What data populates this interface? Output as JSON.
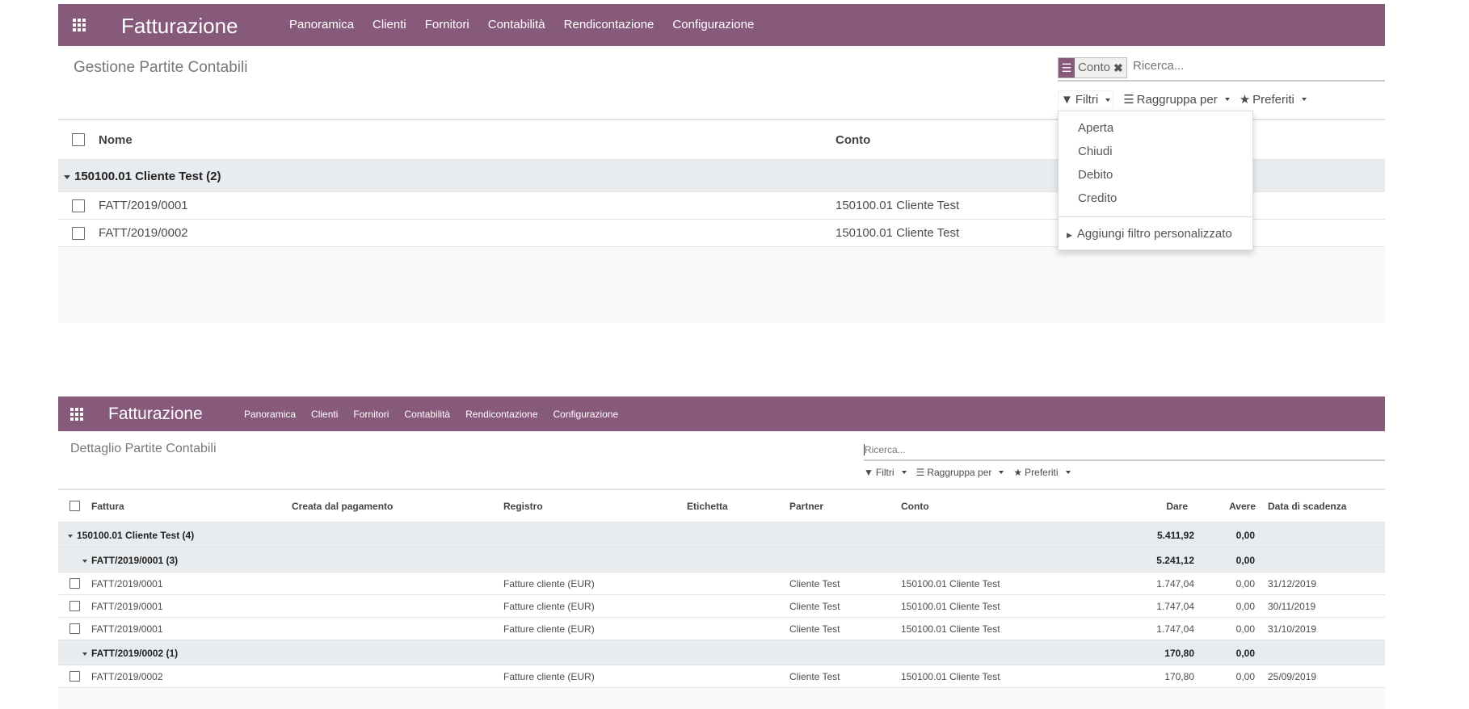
{
  "colors": {
    "brand": "#875a7b",
    "group_bg": "#e9ecef"
  },
  "top": {
    "app_title": "Fatturazione",
    "menu": [
      "Panoramica",
      "Clienti",
      "Fornitori",
      "Contabilità",
      "Rendicontazione",
      "Configurazione"
    ],
    "page_title": "Gestione Partite Contabili",
    "search": {
      "facet": "Conto",
      "placeholder": "Ricerca..."
    },
    "toolbar": {
      "filters": "Filtri",
      "group_by": "Raggruppa per",
      "favorites": "Preferiti"
    },
    "columns": {
      "name": "Nome",
      "account": "Conto"
    },
    "group": {
      "label": "150100.01 Cliente Test (2)"
    },
    "rows": [
      {
        "name": "FATT/2019/0001",
        "account": "150100.01 Cliente Test"
      },
      {
        "name": "FATT/2019/0002",
        "account": "150100.01 Cliente Test"
      }
    ],
    "filter_menu": {
      "items": [
        "Aperta",
        "Chiudi",
        "Debito",
        "Credito"
      ],
      "custom": "Aggiungi filtro personalizzato"
    }
  },
  "bottom": {
    "app_title": "Fatturazione",
    "menu": [
      "Panoramica",
      "Clienti",
      "Fornitori",
      "Contabilità",
      "Rendicontazione",
      "Configurazione"
    ],
    "page_title": "Dettaglio Partite Contabili",
    "search": {
      "placeholder": "Ricerca..."
    },
    "toolbar": {
      "filters": "Filtri",
      "group_by": "Raggruppa per",
      "favorites": "Preferiti"
    },
    "columns": {
      "invoice": "Fattura",
      "created_by_payment": "Creata dal pagamento",
      "journal": "Registro",
      "label": "Etichetta",
      "partner": "Partner",
      "account": "Conto",
      "debit": "Dare",
      "credit": "Avere",
      "due_date": "Data di scadenza"
    },
    "lines": [
      {
        "type": "group",
        "level": 0,
        "label": "150100.01 Cliente Test (4)",
        "debit": "5.411,92",
        "credit": "0,00"
      },
      {
        "type": "group",
        "level": 1,
        "label": "FATT/2019/0001 (3)",
        "debit": "5.241,12",
        "credit": "0,00"
      },
      {
        "type": "row",
        "invoice": "FATT/2019/0001",
        "journal": "Fatture cliente (EUR)",
        "partner": "Cliente Test",
        "account": "150100.01 Cliente Test",
        "debit": "1.747,04",
        "credit": "0,00",
        "due_date": "31/12/2019"
      },
      {
        "type": "row",
        "invoice": "FATT/2019/0001",
        "journal": "Fatture cliente (EUR)",
        "partner": "Cliente Test",
        "account": "150100.01 Cliente Test",
        "debit": "1.747,04",
        "credit": "0,00",
        "due_date": "30/11/2019"
      },
      {
        "type": "row",
        "invoice": "FATT/2019/0001",
        "journal": "Fatture cliente (EUR)",
        "partner": "Cliente Test",
        "account": "150100.01 Cliente Test",
        "debit": "1.747,04",
        "credit": "0,00",
        "due_date": "31/10/2019"
      },
      {
        "type": "group",
        "level": 1,
        "label": "FATT/2019/0002 (1)",
        "debit": "170,80",
        "credit": "0,00"
      },
      {
        "type": "row",
        "invoice": "FATT/2019/0002",
        "journal": "Fatture cliente (EUR)",
        "partner": "Cliente Test",
        "account": "150100.01 Cliente Test",
        "debit": "170,80",
        "credit": "0,00",
        "due_date": "25/09/2019"
      }
    ]
  }
}
